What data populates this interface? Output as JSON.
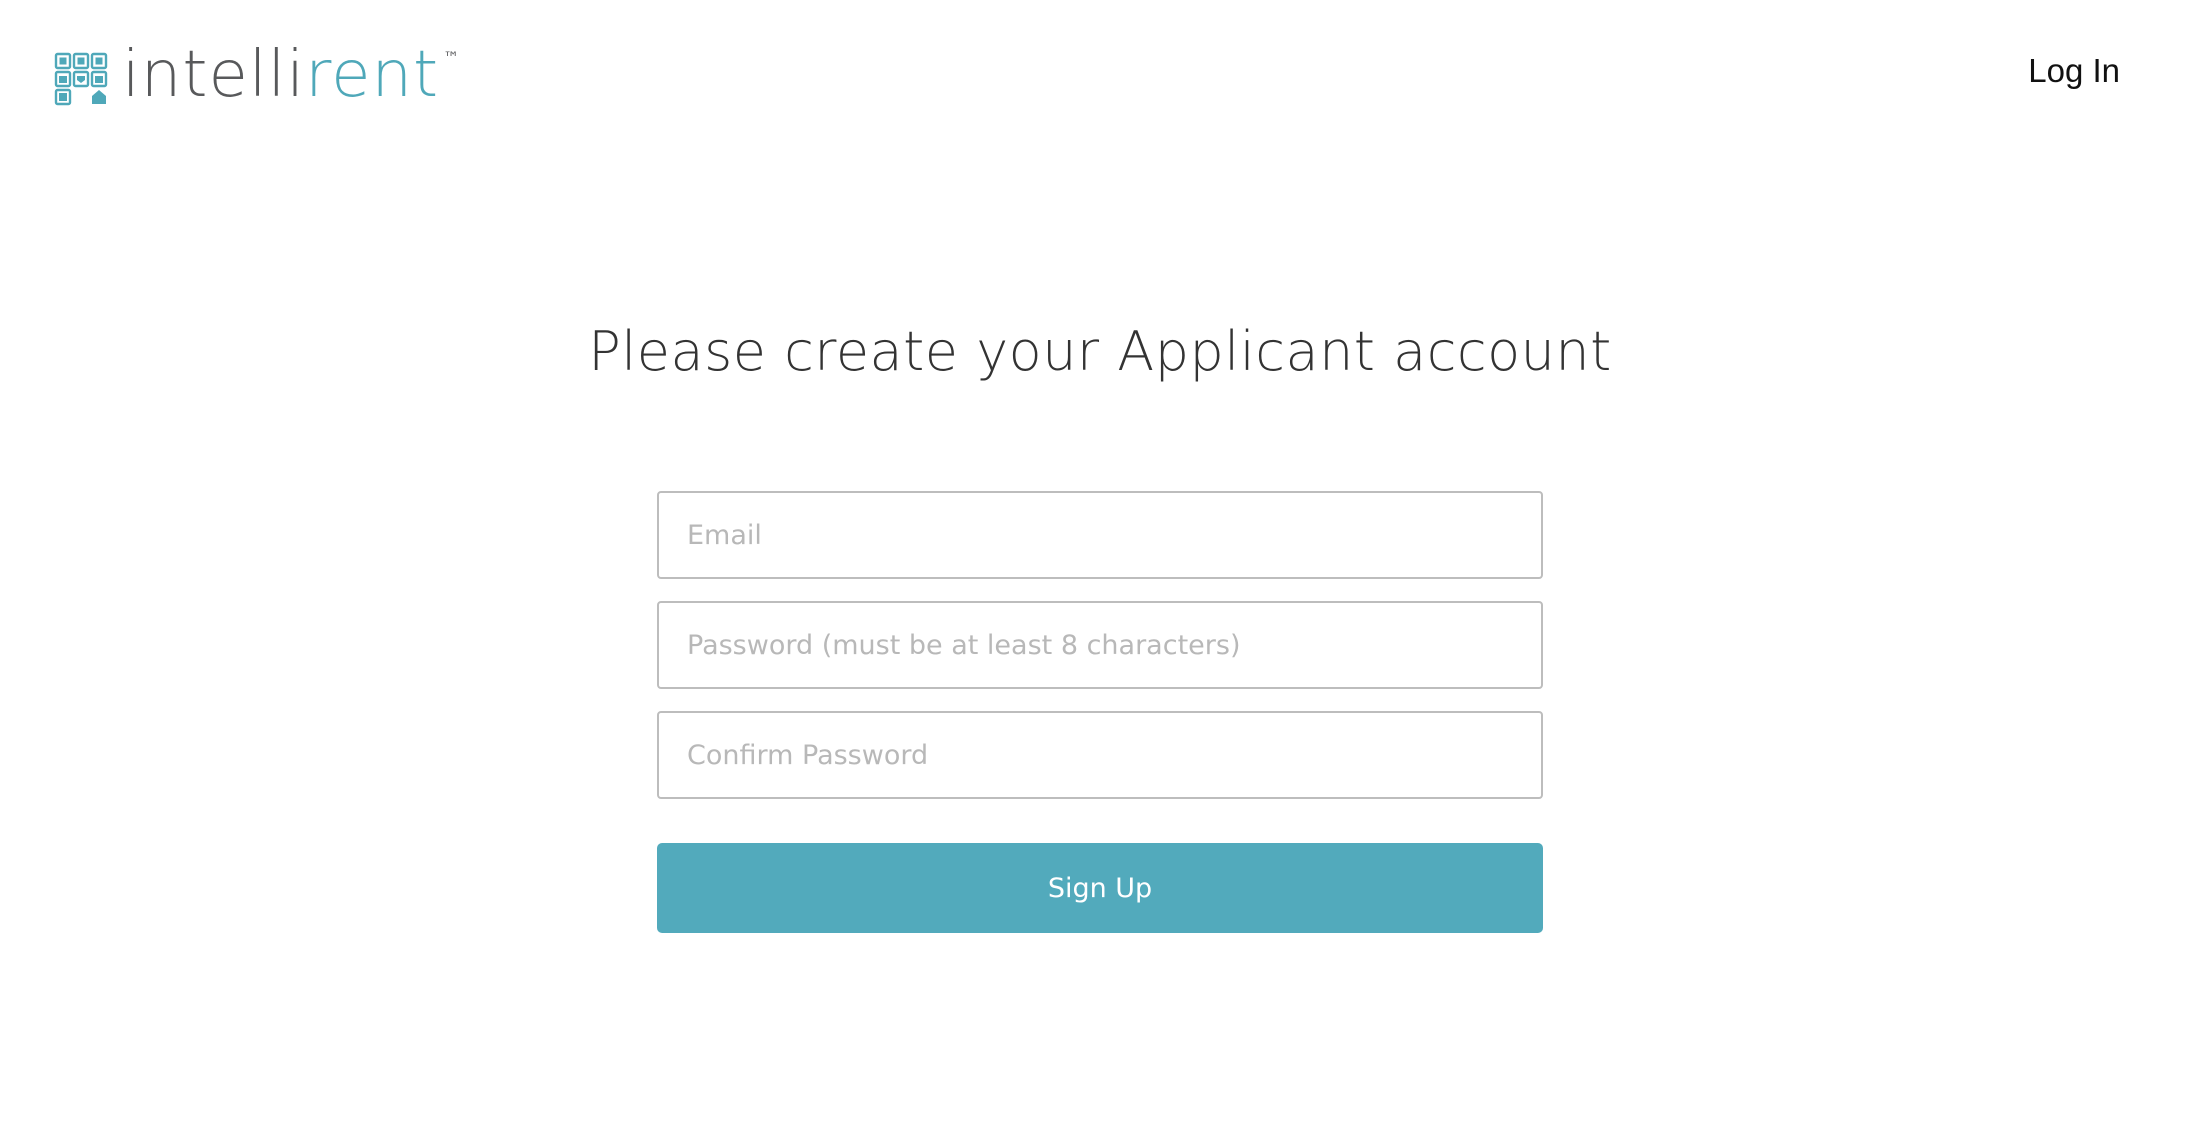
{
  "header": {
    "logo": {
      "word_main": "intelli",
      "word_accent": "rent",
      "trademark": "™",
      "icon": "intellirent-grid-logo-icon"
    },
    "login_label": "Log In"
  },
  "main": {
    "title": "Please create your Applicant account",
    "fields": {
      "email_placeholder": "Email",
      "password_placeholder": "Password (must be at least 8 characters)",
      "confirm_placeholder": "Confirm Password"
    },
    "submit_label": "Sign Up"
  },
  "colors": {
    "brand": "#4fa8b9",
    "button": "#52aabc",
    "text_dark": "#333333",
    "input_border": "#bdbdbd"
  }
}
